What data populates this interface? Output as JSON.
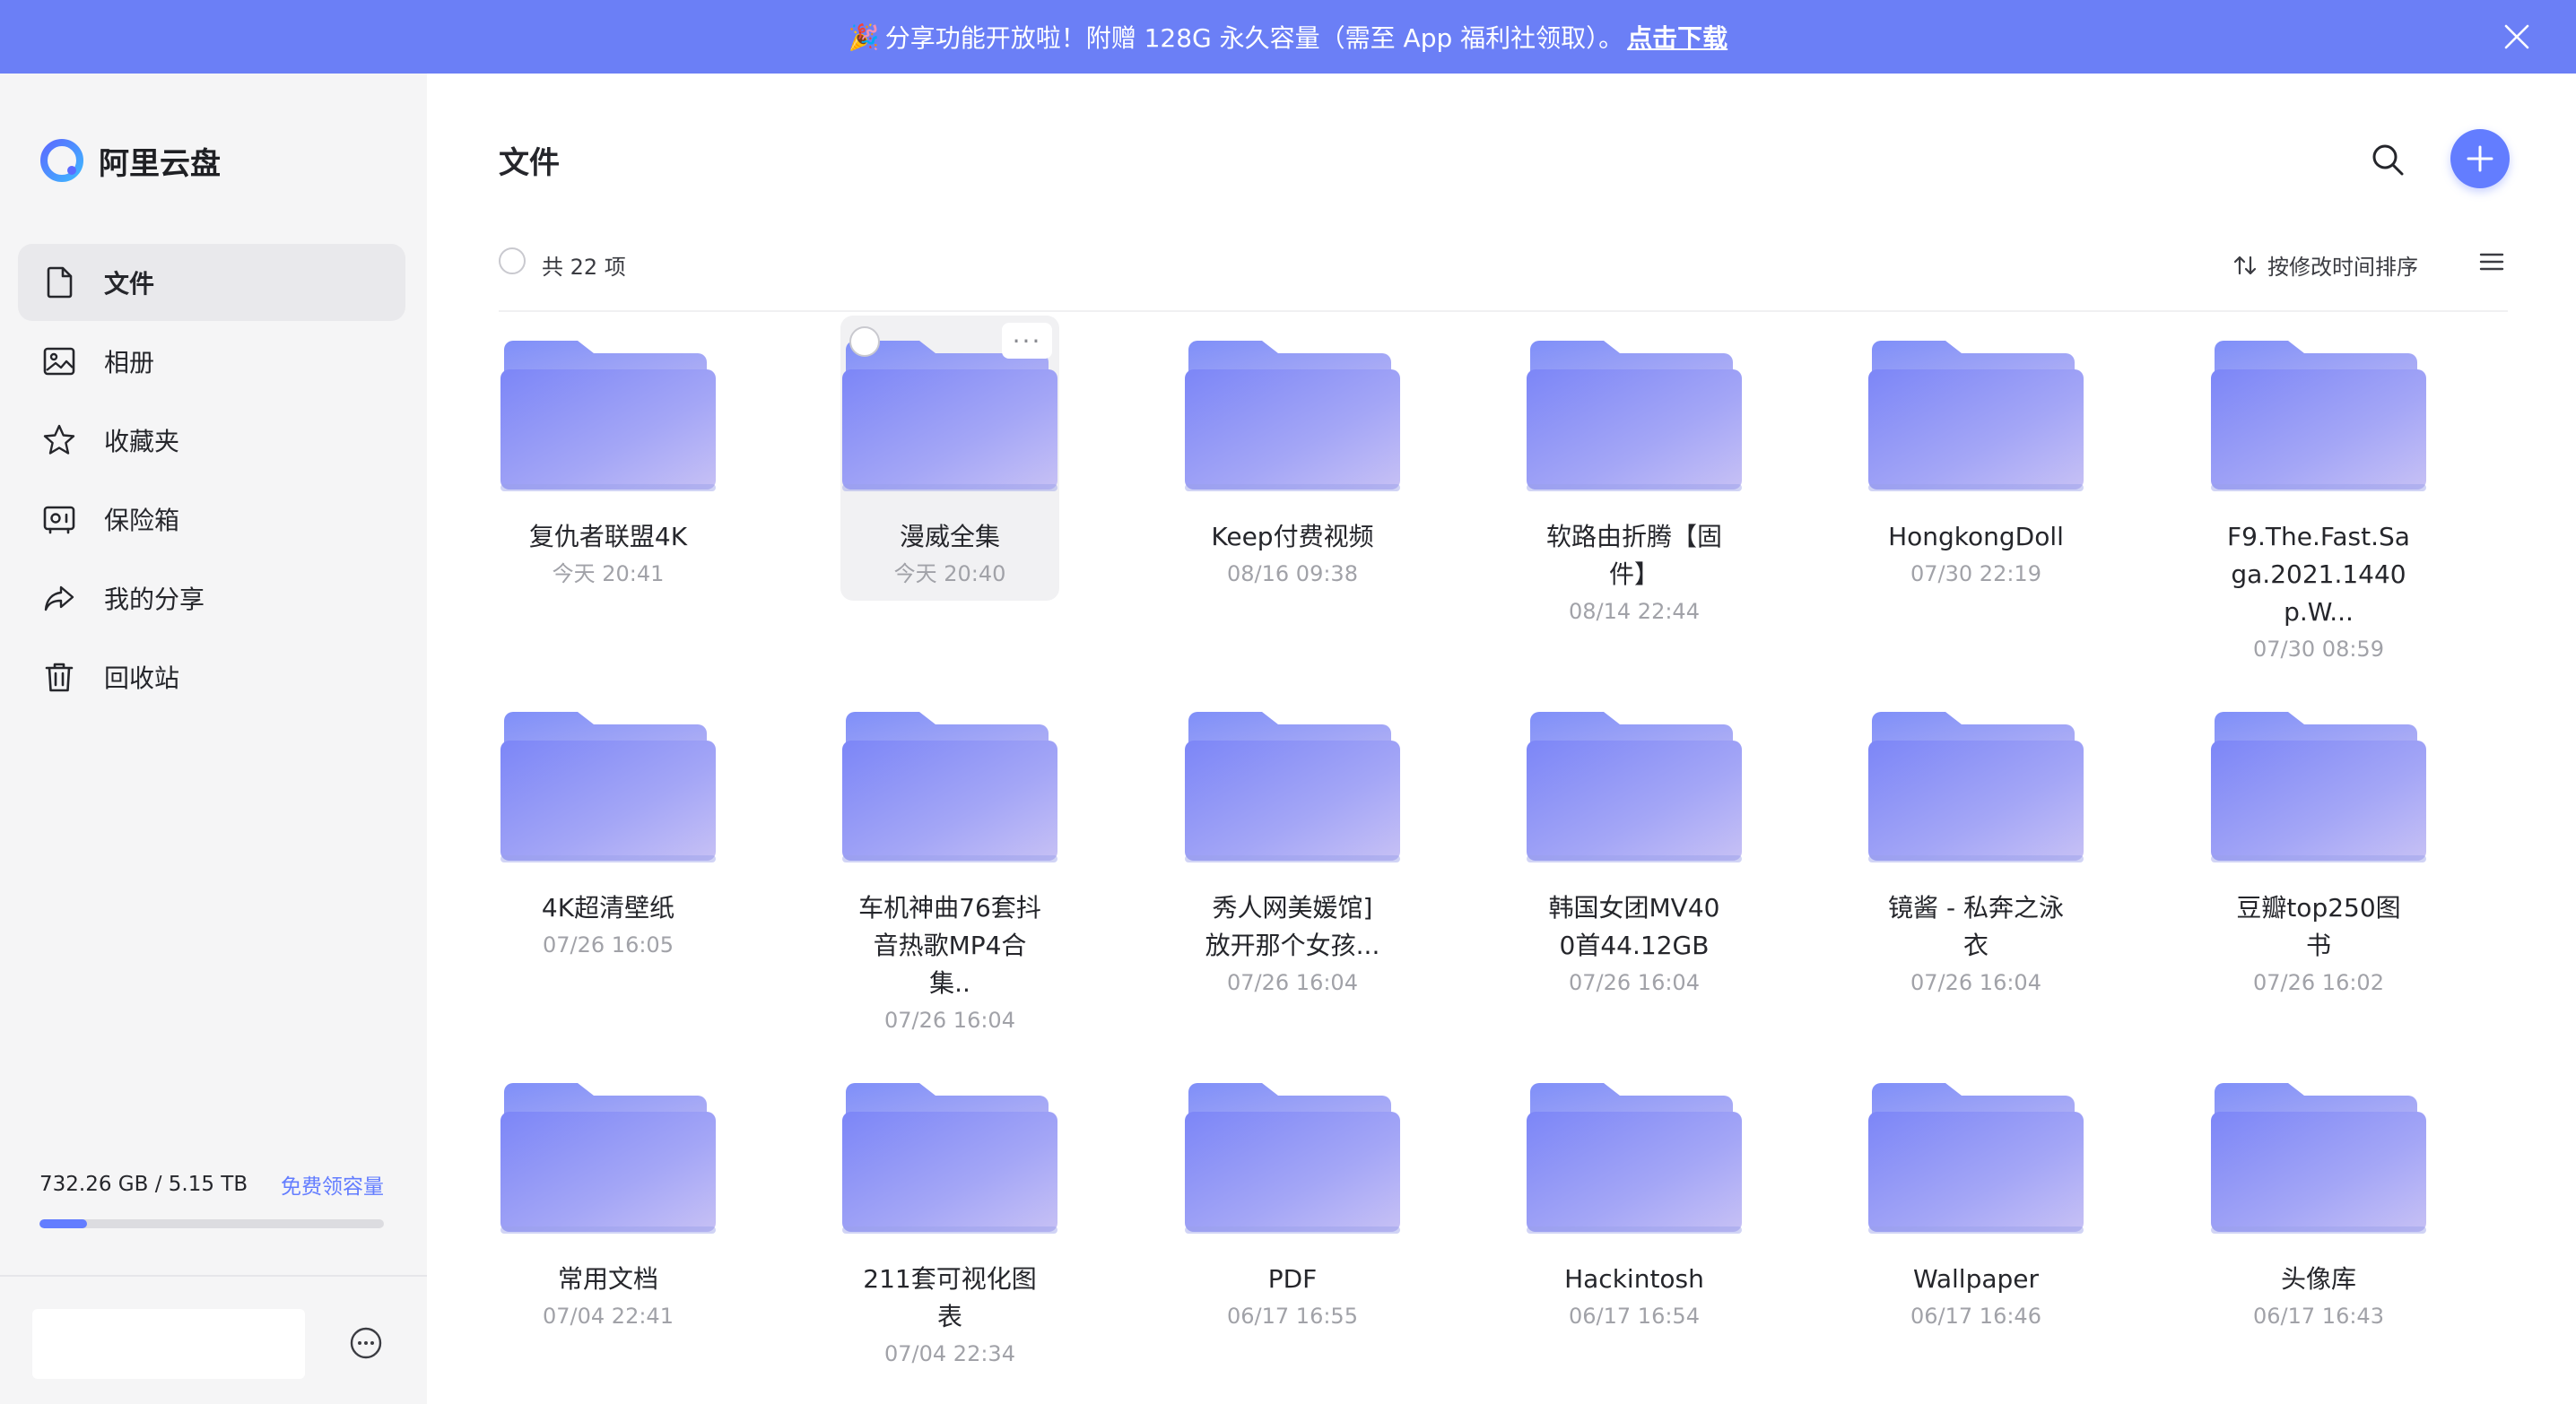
{
  "banner": {
    "text": "分享功能开放啦！附赠 128G 永久容量（需至 App 福利社领取）。",
    "link": "点击下载"
  },
  "sidebar": {
    "logo_text": "阿里云盘",
    "items": [
      {
        "label": "文件",
        "icon": "file-icon",
        "active": true
      },
      {
        "label": "相册",
        "icon": "photo-icon",
        "active": false
      },
      {
        "label": "收藏夹",
        "icon": "star-icon",
        "active": false
      },
      {
        "label": "保险箱",
        "icon": "safe-icon",
        "active": false
      },
      {
        "label": "我的分享",
        "icon": "share-icon",
        "active": false
      },
      {
        "label": "回收站",
        "icon": "trash-icon",
        "active": false
      }
    ],
    "storage": {
      "used_text": "732.26 GB / 5.15 TB",
      "free_link": "免费领容量",
      "used_fraction": 0.139
    }
  },
  "main": {
    "title": "文件",
    "count": "共 22 项",
    "sort_label": "按修改时间排序",
    "accent": "#637dff",
    "files": [
      {
        "name": "复仇者联盟4K",
        "time": "今天 20:41"
      },
      {
        "name": "漫威全集",
        "time": "今天 20:40",
        "hover": true
      },
      {
        "name": "Keep付费视频",
        "time": "08/16 09:38"
      },
      {
        "name": "软路由折腾【固件】",
        "time": "08/14 22:44"
      },
      {
        "name": "HongkongDoll",
        "time": "07/30 22:19"
      },
      {
        "name": "F9.The.Fast.Saga.2021.1440p.W...",
        "time": "07/30 08:59"
      },
      {
        "name": "4K超清壁纸",
        "time": "07/26 16:05"
      },
      {
        "name": "车机神曲76套抖音热歌MP4合集..",
        "time": "07/26 16:04"
      },
      {
        "name": "秀人网美媛馆]放开那个女孩...",
        "time": "07/26 16:04"
      },
      {
        "name": "韩国女团MV400首44.12GB",
        "time": "07/26 16:04"
      },
      {
        "name": "镜酱 - 私奔之泳衣",
        "time": "07/26 16:04"
      },
      {
        "name": "豆瓣top250图书",
        "time": "07/26 16:02"
      },
      {
        "name": "常用文档",
        "time": "07/04 22:41"
      },
      {
        "name": "211套可视化图表",
        "time": "07/04 22:34"
      },
      {
        "name": "PDF",
        "time": "06/17 16:55"
      },
      {
        "name": "Hackintosh",
        "time": "06/17 16:54"
      },
      {
        "name": "Wallpaper",
        "time": "06/17 16:46"
      },
      {
        "name": "头像库",
        "time": "06/17 16:43"
      }
    ]
  }
}
